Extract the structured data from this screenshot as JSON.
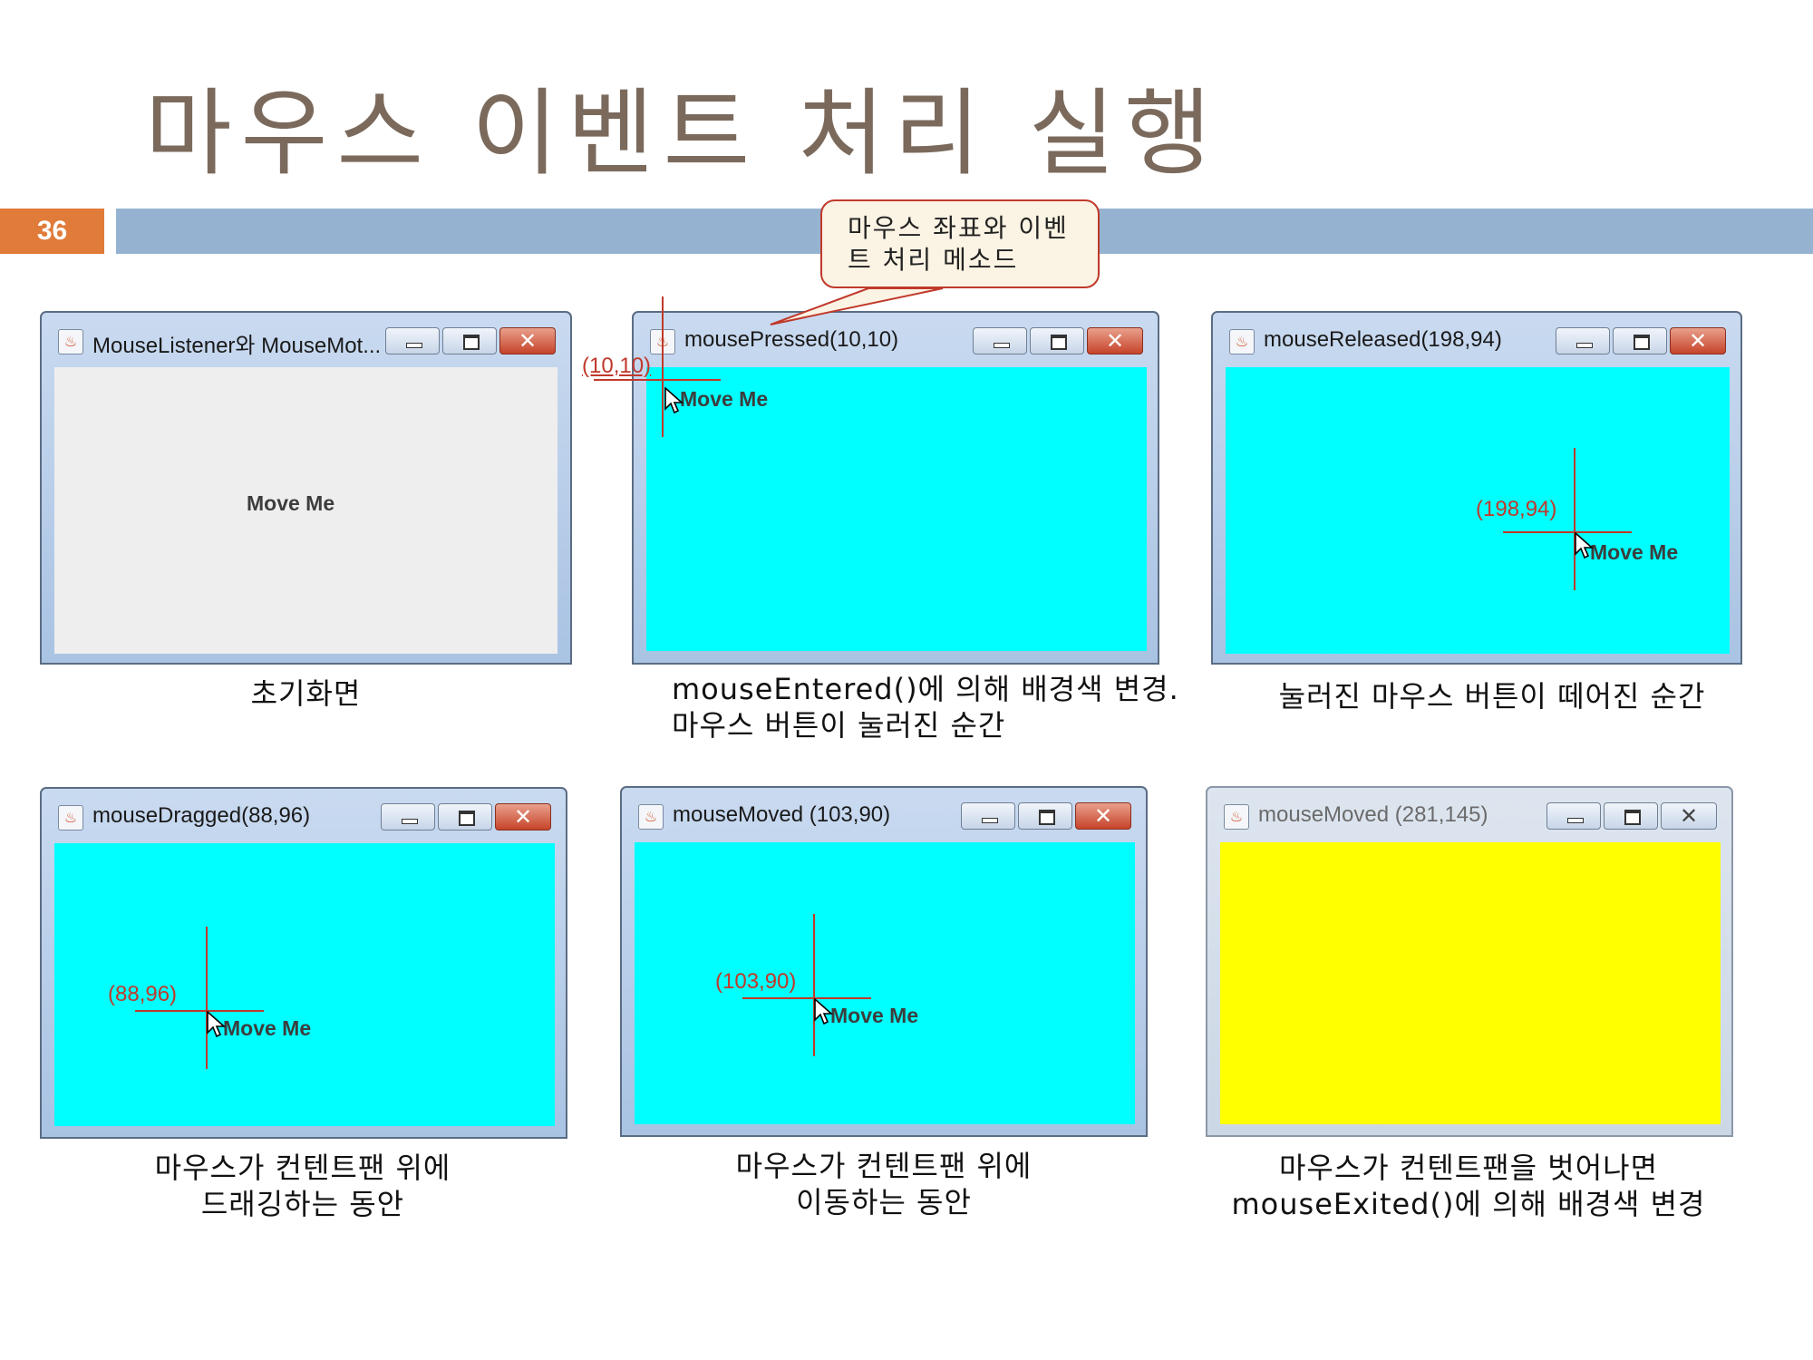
{
  "slide": {
    "title": "마우스 이벤트 처리 실행",
    "page_number": "36"
  },
  "callout": {
    "lines": [
      "마우스 좌표와 이벤",
      "트 처리 메소드"
    ]
  },
  "button_label": "Move Me",
  "colors": {
    "cyan": "#00ffff",
    "yellow": "#ffff00",
    "gray": "#eeeeee",
    "accent_red": "#c0392b",
    "page_badge": "#e07b39",
    "title_band": "#95b3d1"
  },
  "icons": [
    "java-app-icon",
    "minimize-icon",
    "maximize-icon",
    "close-icon",
    "mouse-cursor-icon"
  ],
  "windows": [
    {
      "title": "MouseListener와 MouseMot...",
      "coord": "",
      "caption": [
        "초기화면"
      ]
    },
    {
      "title": "mousePressed(10,10)",
      "coord": "(10,10)",
      "caption": [
        "mouseEntered()에 의해 배경색 변경.",
        "마우스 버튼이 눌러진 순간"
      ]
    },
    {
      "title": "mouseReleased(198,94)",
      "coord": "(198,94)",
      "caption": [
        "눌러진 마우스 버튼이 떼어진 순간"
      ]
    },
    {
      "title": "mouseDragged(88,96)",
      "coord": "(88,96)",
      "caption": [
        "마우스가 컨텐트팬 위에",
        "드래깅하는 동안"
      ]
    },
    {
      "title": "mouseMoved (103,90)",
      "coord": "(103,90)",
      "caption": [
        "마우스가 컨텐트팬 위에",
        "이동하는 동안"
      ]
    },
    {
      "title": "mouseMoved (281,145)",
      "coord": "",
      "caption": [
        "마우스가 컨텐트팬을 벗어나면",
        "mouseExited()에 의해 배경색 변경"
      ]
    }
  ]
}
